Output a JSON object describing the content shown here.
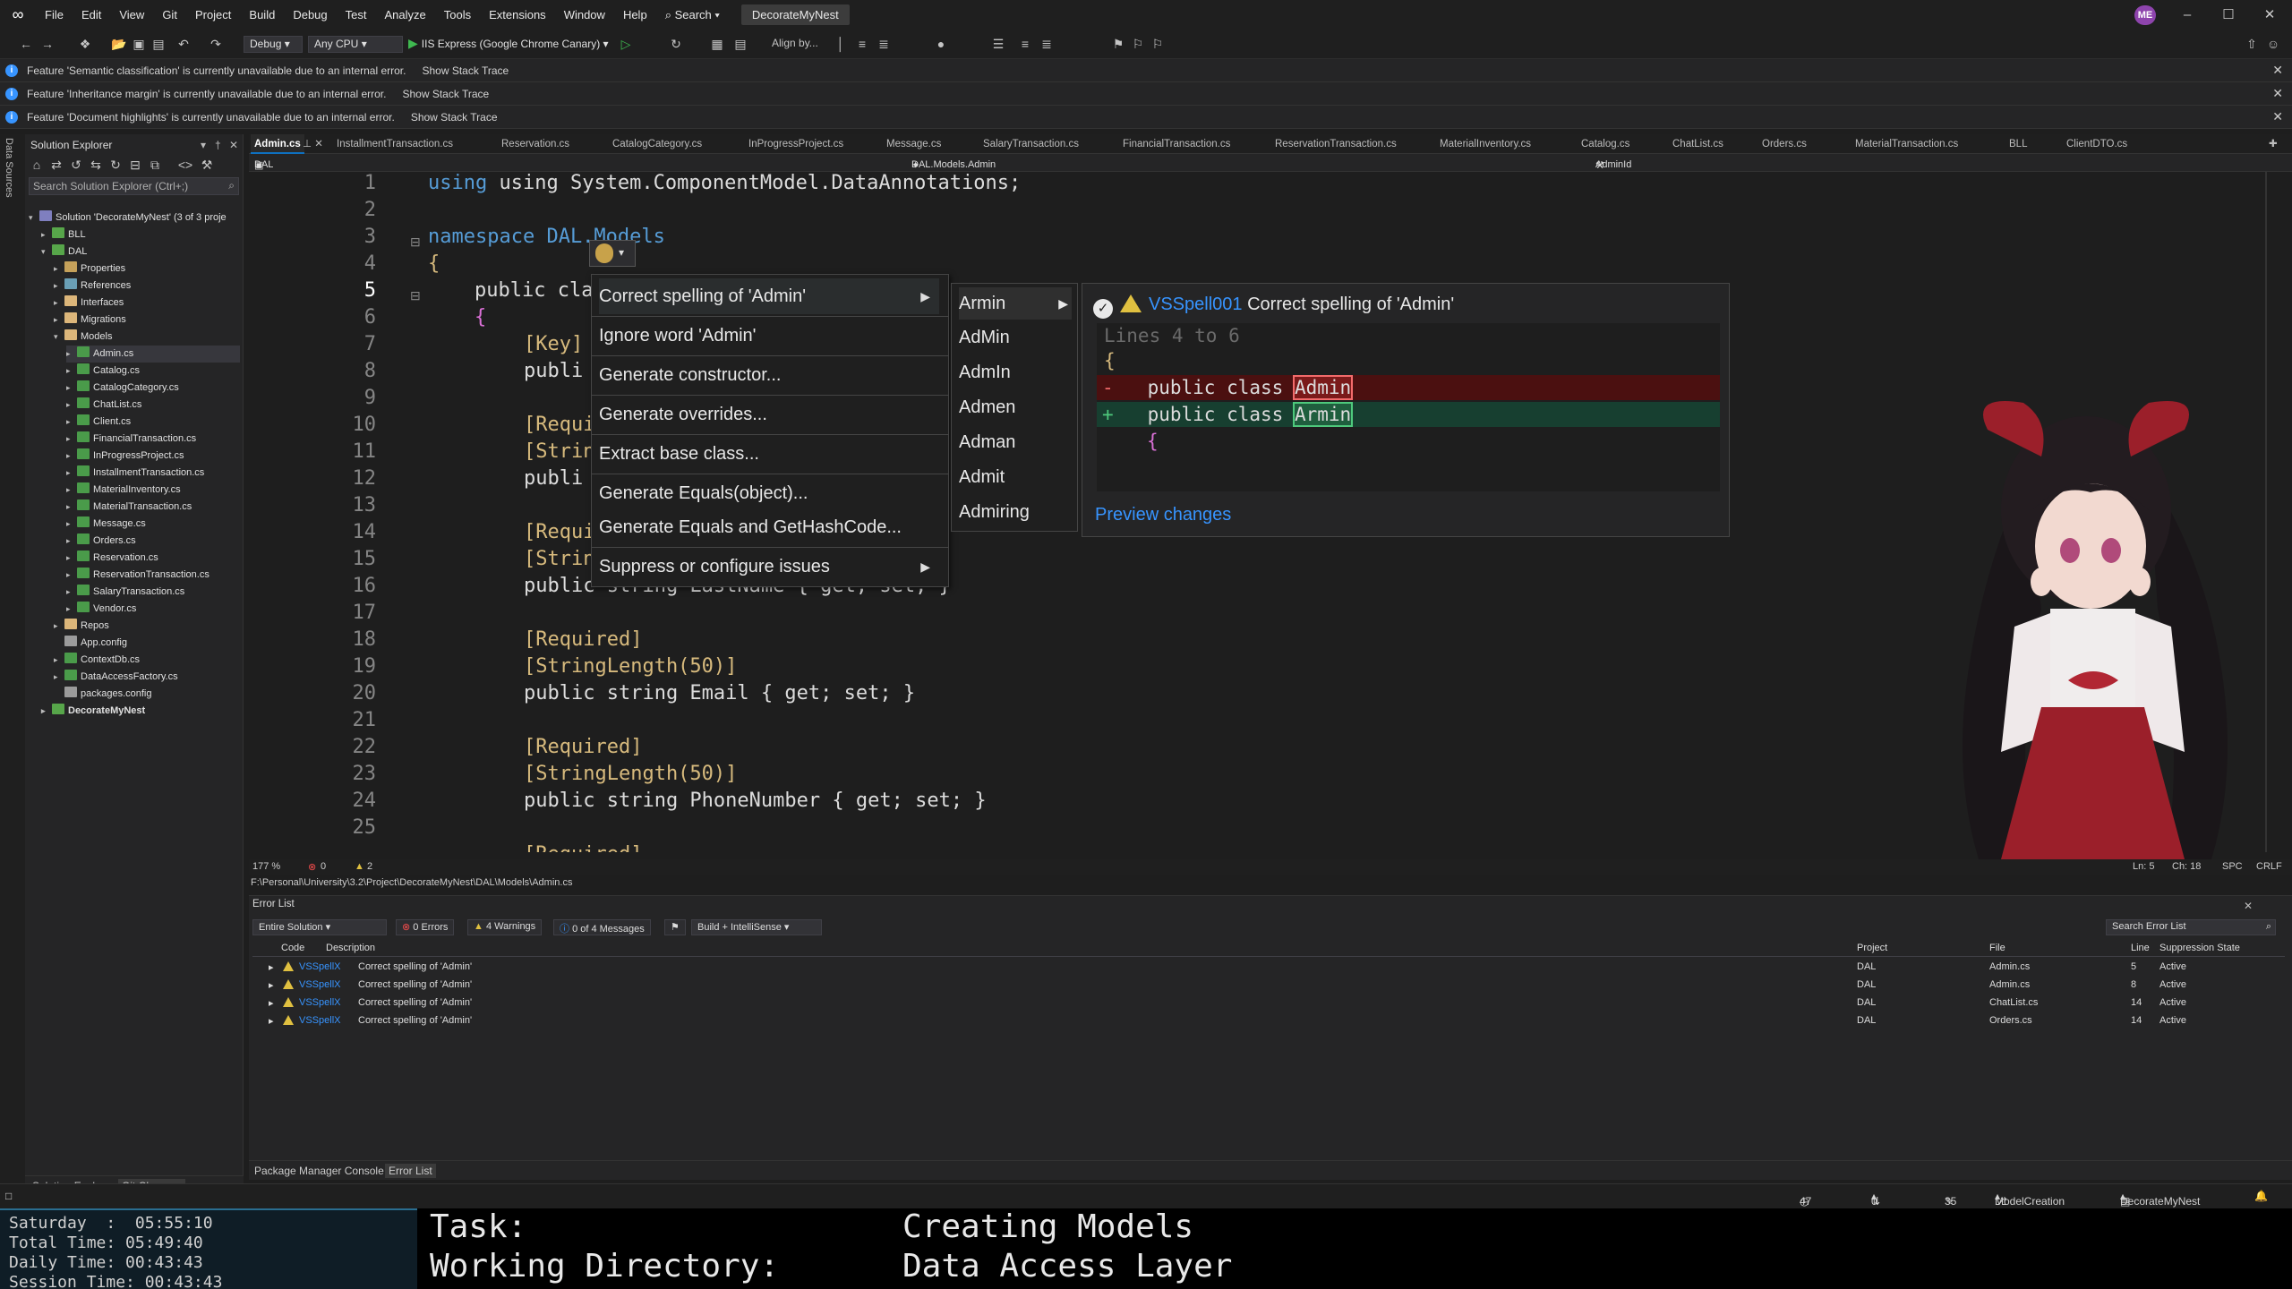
{
  "menu": {
    "items": [
      "File",
      "Edit",
      "View",
      "Git",
      "Project",
      "Build",
      "Debug",
      "Test",
      "Analyze",
      "Tools",
      "Extensions",
      "Window",
      "Help"
    ],
    "search": "Search",
    "solution": "DecorateMyNest",
    "avatar": "ME"
  },
  "toolbar": {
    "config": "Debug",
    "platform": "Any CPU",
    "run": "IIS Express (Google Chrome Canary)",
    "align": "Align by..."
  },
  "infobars": [
    {
      "text": "Feature 'Semantic classification' is currently unavailable due to an internal error.",
      "link": "Show Stack Trace"
    },
    {
      "text": "Feature 'Inheritance margin' is currently unavailable due to an internal error.",
      "link": "Show Stack Trace"
    },
    {
      "text": "Feature 'Document highlights' is currently unavailable due to an internal error.",
      "link": "Show Stack Trace"
    }
  ],
  "left_strip": "Data Sources",
  "solution_explorer": {
    "title": "Solution Explorer",
    "search_placeholder": "Search Solution Explorer (Ctrl+;)",
    "tree": [
      "Solution 'DecorateMyNest' (3 of 3 proje",
      "BLL",
      "DAL",
      "Properties",
      "References",
      "Interfaces",
      "Migrations",
      "Models",
      "Admin.cs",
      "Catalog.cs",
      "CatalogCategory.cs",
      "ChatList.cs",
      "Client.cs",
      "FinancialTransaction.cs",
      "InProgressProject.cs",
      "InstallmentTransaction.cs",
      "MaterialInventory.cs",
      "MaterialTransaction.cs",
      "Message.cs",
      "Orders.cs",
      "Reservation.cs",
      "ReservationTransaction.cs",
      "SalaryTransaction.cs",
      "Vendor.cs",
      "Repos",
      "App.config",
      "ContextDb.cs",
      "DataAccessFactory.cs",
      "packages.config",
      "DecorateMyNest"
    ],
    "bottom_tabs": [
      "Solution Explorer",
      "Git Changes"
    ]
  },
  "editor_tabs": [
    "Admin.cs",
    "InstallmentTransaction.cs",
    "Reservation.cs",
    "CatalogCategory.cs",
    "InProgressProject.cs",
    "Message.cs",
    "SalaryTransaction.cs",
    "FinancialTransaction.cs",
    "ReservationTransaction.cs",
    "MaterialInventory.cs",
    "Catalog.cs",
    "ChatList.cs",
    "Orders.cs",
    "MaterialTransaction.cs",
    "BLL",
    "ClientDTO.cs"
  ],
  "navbar": {
    "project": "DAL",
    "type": "DAL.Models.Admin",
    "member": "AdminId"
  },
  "code": {
    "line_numbers": [
      "1",
      "2",
      "3",
      "4",
      "5",
      "6",
      "7",
      "8",
      "9",
      "10",
      "11",
      "12",
      "13",
      "14",
      "15",
      "16",
      "17",
      "18",
      "19",
      "20",
      "21",
      "22",
      "23",
      "24",
      "25"
    ],
    "line1": "using System.ComponentModel.DataAnnotations;",
    "line3": "namespace DAL.Models",
    "line5": "public cla",
    "line7": "[Key]",
    "line8": "publi",
    "line10": "[Requi",
    "line11": "[Strin",
    "line12": "publi",
    "line14": "[Requi",
    "line15": "[Strin",
    "line16": "public string LastName { get; set; }",
    "line18": "[Required]",
    "line19": "[StringLength(50)]",
    "line20": "public string Email { get; set; }",
    "line22": "[Required]",
    "line23": "[StringLength(50)]",
    "line24": "public string PhoneNumber { get; set; }",
    "line25": "[Required]"
  },
  "quick_actions": {
    "items": [
      "Correct spelling of 'Admin'",
      "Ignore word 'Admin'",
      "Generate constructor...",
      "Generate overrides...",
      "Extract base class...",
      "Generate Equals(object)...",
      "Generate Equals and GetHashCode...",
      "Suppress or configure issues"
    ],
    "suggestions": [
      "Armin",
      "AdMin",
      "AdmIn",
      "Admen",
      "Adman",
      "Admit",
      "Admiring"
    ]
  },
  "preview": {
    "code_id": "VSSpell001",
    "message": "Correct spelling of 'Admin'",
    "range": "Lines 4 to 6",
    "brace_open": "{",
    "del_prefix": "public class ",
    "del_word": "Admin",
    "add_prefix": "public class ",
    "add_word": "Armin",
    "inner_brace": "{",
    "link": "Preview changes"
  },
  "editor_status": {
    "zoom": "177 %",
    "errors": "0",
    "warnings": "2",
    "ln": "Ln: 5",
    "ch": "Ch: 18",
    "spc": "SPC",
    "crlf": "CRLF"
  },
  "file_path": "F:\\Personal\\University\\3.2\\Project\\DecorateMyNest\\DAL\\Models\\Admin.cs",
  "error_list": {
    "title": "Error List",
    "scope": "Entire Solution",
    "errors_btn": "0 Errors",
    "warnings_btn": "4 Warnings",
    "messages_btn": "0 of 4 Messages",
    "build": "Build + IntelliSense",
    "search": "Search Error List",
    "headers": [
      "Code",
      "Description",
      "Project",
      "File",
      "Line",
      "Suppression State"
    ],
    "rows": [
      {
        "code": "VSSpellX",
        "desc": "Correct spelling of 'Admin'",
        "project": "DAL",
        "file": "Admin.cs",
        "line": "5",
        "state": "Active"
      },
      {
        "code": "VSSpellX",
        "desc": "Correct spelling of 'Admin'",
        "project": "DAL",
        "file": "Admin.cs",
        "line": "8",
        "state": "Active"
      },
      {
        "code": "VSSpellX",
        "desc": "Correct spelling of 'Admin'",
        "project": "DAL",
        "file": "ChatList.cs",
        "line": "14",
        "state": "Active"
      },
      {
        "code": "VSSpellX",
        "desc": "Correct spelling of 'Admin'",
        "project": "DAL",
        "file": "Orders.cs",
        "line": "14",
        "state": "Active"
      }
    ],
    "bottom_tabs": [
      "Package Manager Console",
      "Error List"
    ]
  },
  "statusbar": {
    "time": "47 mins",
    "sync": "0 / 0",
    "edits": "35",
    "branch": "ModelCreation",
    "repo": "DecorateMyNest"
  },
  "timer": {
    "day": "Saturday  :  05:55:10",
    "total": "Total Time: 05:49:40",
    "daily": "Daily Time: 00:43:43",
    "session": "Session Time: 00:43:43"
  },
  "task": {
    "task_label": "Task:",
    "task_value": "Creating Models",
    "dir_label": "Working Directory:",
    "dir_value": "Data Access Layer"
  }
}
